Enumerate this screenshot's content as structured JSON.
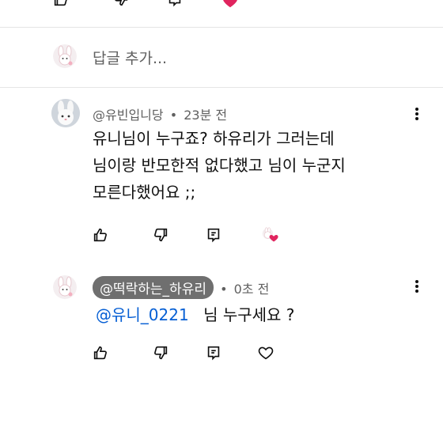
{
  "reply_box": {
    "placeholder": "답글 추가..."
  },
  "comments": [
    {
      "author": "@유빈입니당",
      "separator": "•",
      "time": "23분 전",
      "lines": [
        "유니님이 누구죠? 하유리가 그러는데",
        "님이랑 반모한적 없다했고 님이 누군지",
        "모른다했어요 ;;"
      ],
      "avatar_icon": "bunny-avatar-icon"
    },
    {
      "author": "@떡락하는_하유리",
      "separator": "•",
      "time": "0초 전",
      "mention": "@유니_0221",
      "text": "님 누구세요 ?",
      "avatar_icon": "bunny-avatar-icon"
    }
  ],
  "icons": {
    "like": "thumbs-up-icon",
    "dislike": "thumbs-down-icon",
    "reply": "reply-icon",
    "heart": "heart-icon",
    "more": "more-vert-icon"
  },
  "colors": {
    "text": "#0f0f0f",
    "meta": "#606060",
    "mention_chip": "#6f6f6f",
    "link": "#065fd4",
    "heart": "#e0245e",
    "divider": "#e5e5e5"
  }
}
